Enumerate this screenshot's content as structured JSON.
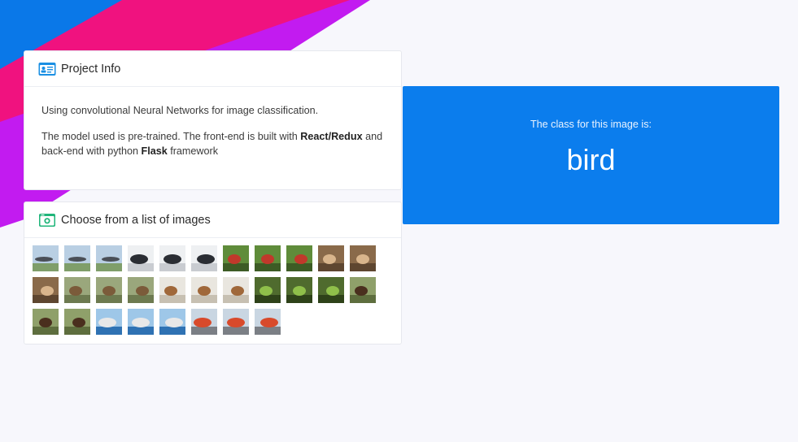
{
  "project_info": {
    "title": "Project Info",
    "icon": "id-card-icon",
    "paragraph1": "Using convolutional Neural Networks for image classification.",
    "p2_part1": "The model used is pre-trained. The front-end is built with ",
    "p2_bold1": "React/Redux",
    "p2_part2": " and back-end with python ",
    "p2_bold2": "Flask",
    "p2_part3": " framework"
  },
  "image_list": {
    "title": "Choose from a list of images",
    "icon": "camera-icon",
    "thumbnails": [
      {
        "subject": "airplane"
      },
      {
        "subject": "airplane"
      },
      {
        "subject": "airplane"
      },
      {
        "subject": "automobile"
      },
      {
        "subject": "automobile"
      },
      {
        "subject": "automobile"
      },
      {
        "subject": "bird"
      },
      {
        "subject": "bird"
      },
      {
        "subject": "bird"
      },
      {
        "subject": "cat"
      },
      {
        "subject": "cat"
      },
      {
        "subject": "cat"
      },
      {
        "subject": "deer"
      },
      {
        "subject": "deer"
      },
      {
        "subject": "deer"
      },
      {
        "subject": "dog"
      },
      {
        "subject": "dog"
      },
      {
        "subject": "dog"
      },
      {
        "subject": "frog"
      },
      {
        "subject": "frog"
      },
      {
        "subject": "frog"
      },
      {
        "subject": "horse"
      },
      {
        "subject": "horse"
      },
      {
        "subject": "horse"
      },
      {
        "subject": "ship"
      },
      {
        "subject": "ship"
      },
      {
        "subject": "ship"
      },
      {
        "subject": "truck"
      },
      {
        "subject": "truck"
      },
      {
        "subject": "truck"
      }
    ]
  },
  "result": {
    "label": "The class for this image is:",
    "value": "bird"
  },
  "colors": {
    "accent_blue": "#0b7ded",
    "bg_blue": "#0a78e8",
    "bg_pink": "#f0127f",
    "bg_purple": "#c21bf0",
    "page_bg": "#f7f7fc"
  }
}
